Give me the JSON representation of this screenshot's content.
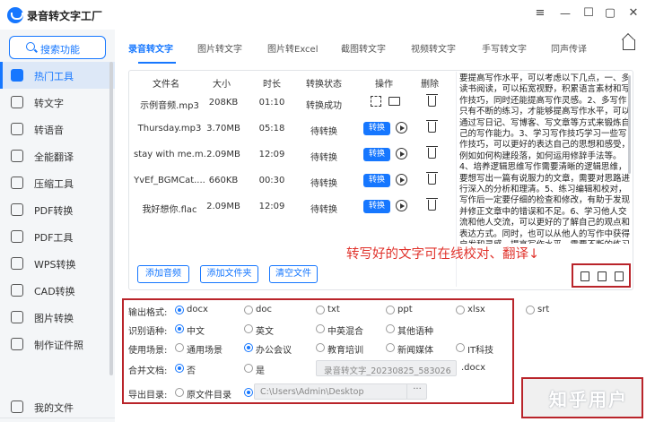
{
  "app": {
    "title": "录音转文字工厂",
    "window_controls": [
      "minimize-icon",
      "maximize-icon",
      "close-icon",
      "menu-icon"
    ]
  },
  "sidebar": {
    "search_label": "搜索功能",
    "items": [
      {
        "label": "热门工具",
        "icon": "flame-icon",
        "active": true
      },
      {
        "label": "转文字",
        "icon": "text-convert-icon",
        "active": false
      },
      {
        "label": "转语音",
        "icon": "speech-icon",
        "active": false
      },
      {
        "label": "全能翻译",
        "icon": "translate-icon",
        "active": false
      },
      {
        "label": "压缩工具",
        "icon": "compress-icon",
        "active": false
      },
      {
        "label": "PDF转换",
        "icon": "pdf-convert-icon",
        "active": false
      },
      {
        "label": "PDF工具",
        "icon": "pdf-tool-icon",
        "active": false
      },
      {
        "label": "WPS转换",
        "icon": "wps-icon",
        "active": false
      },
      {
        "label": "CAD转换",
        "icon": "cad-icon",
        "active": false
      },
      {
        "label": "图片转换",
        "icon": "image-convert-icon",
        "active": false
      },
      {
        "label": "制作证件照",
        "icon": "id-photo-icon",
        "active": false
      }
    ],
    "footer_label": "我的文件"
  },
  "tabs": [
    "录音转文字",
    "图片转文字",
    "图片转Excel",
    "截图转文字",
    "视频转文字",
    "手写转文字",
    "同声传译"
  ],
  "table": {
    "headers": [
      "文件名",
      "大小",
      "时长",
      "转换状态",
      "操作",
      "删除"
    ],
    "rows": [
      {
        "name": "示例音频.mp3",
        "size": "208KB",
        "duration": "01:10",
        "status": "转换成功",
        "done": true
      },
      {
        "name": "Thursday.mp3",
        "size": "3.70MB",
        "duration": "05:18",
        "status": "待转换",
        "done": false
      },
      {
        "name": "stay with me.m...",
        "size": "2.09MB",
        "duration": "12:09",
        "status": "待转换",
        "done": false
      },
      {
        "name": "YvEf_BGMCat....",
        "size": "660KB",
        "duration": "00:30",
        "status": "待转换",
        "done": false
      },
      {
        "name": "我好想你.flac",
        "size": "2.09MB",
        "duration": "12:09",
        "status": "待转换",
        "done": false
      }
    ],
    "convert_label": "转换"
  },
  "result_text": "要提高写作水平，可以考虑以下几点，一、多读书阅读，可以拓宽视野，积累语言素材和写作技巧，同时还能提高写作灵感。2、多写作只有不断的练习，才能够提高写作水平，可以通过写日记、写博客、写文章等方式来锻炼自己的写作能力。3、学习写作技巧学习一些写作技巧，可以更好的表达自己的思想和感受，例如如何构建段落，如何运用修辞手法等。4、培养逻辑思维写作需要清晰的逻辑思维，要想写出一篇有说服力的文章，需要对思路进行深入的分析和理清。5、练习编辑和校对，写作后一定要仔细的检查和修改，有助于发现并修正文章中的错误和不足。6、学习他人交流和他人交流，可以更好的了解自己的观点和表达方式。同时，也可以从他人的写作中获得启发和灵感，提高写作水平。需要不断的练习和学习，同时也需要对自己的写作进行反思和改进。",
  "annotation": "转写好的文字可在线校对、翻译↓",
  "result_tools": [
    "edit-icon",
    "export-icon",
    "copy-icon"
  ],
  "actions": {
    "add_audio": "添加音频",
    "add_folder": "添加文件夹",
    "clear_list": "清空文件"
  },
  "options": {
    "output_format": {
      "label": "输出格式:",
      "choices": [
        "docx",
        "doc",
        "txt",
        "ppt",
        "xlsx",
        "srt"
      ],
      "selected": "docx"
    },
    "language": {
      "label": "识别语种:",
      "choices": [
        "中文",
        "英文",
        "中英混合",
        "其他语种"
      ],
      "selected": "中文"
    },
    "scene": {
      "label": "使用场景:",
      "choices": [
        "通用场景",
        "办公会议",
        "教育培训",
        "新闻媒体",
        "IT科技"
      ],
      "selected": "办公会议"
    },
    "merge": {
      "label": "合并文档:",
      "choices": [
        "否",
        "是"
      ],
      "selected": "否",
      "filename_placeholder": "录音转文字_20230825_583026",
      "ext": ".docx"
    },
    "export_dir": {
      "label": "导出目录:",
      "choices": [
        "原文件目录"
      ],
      "path": "C:\\Users\\Admin\\Desktop",
      "more": "···"
    }
  },
  "watermark": "知乎用户"
}
